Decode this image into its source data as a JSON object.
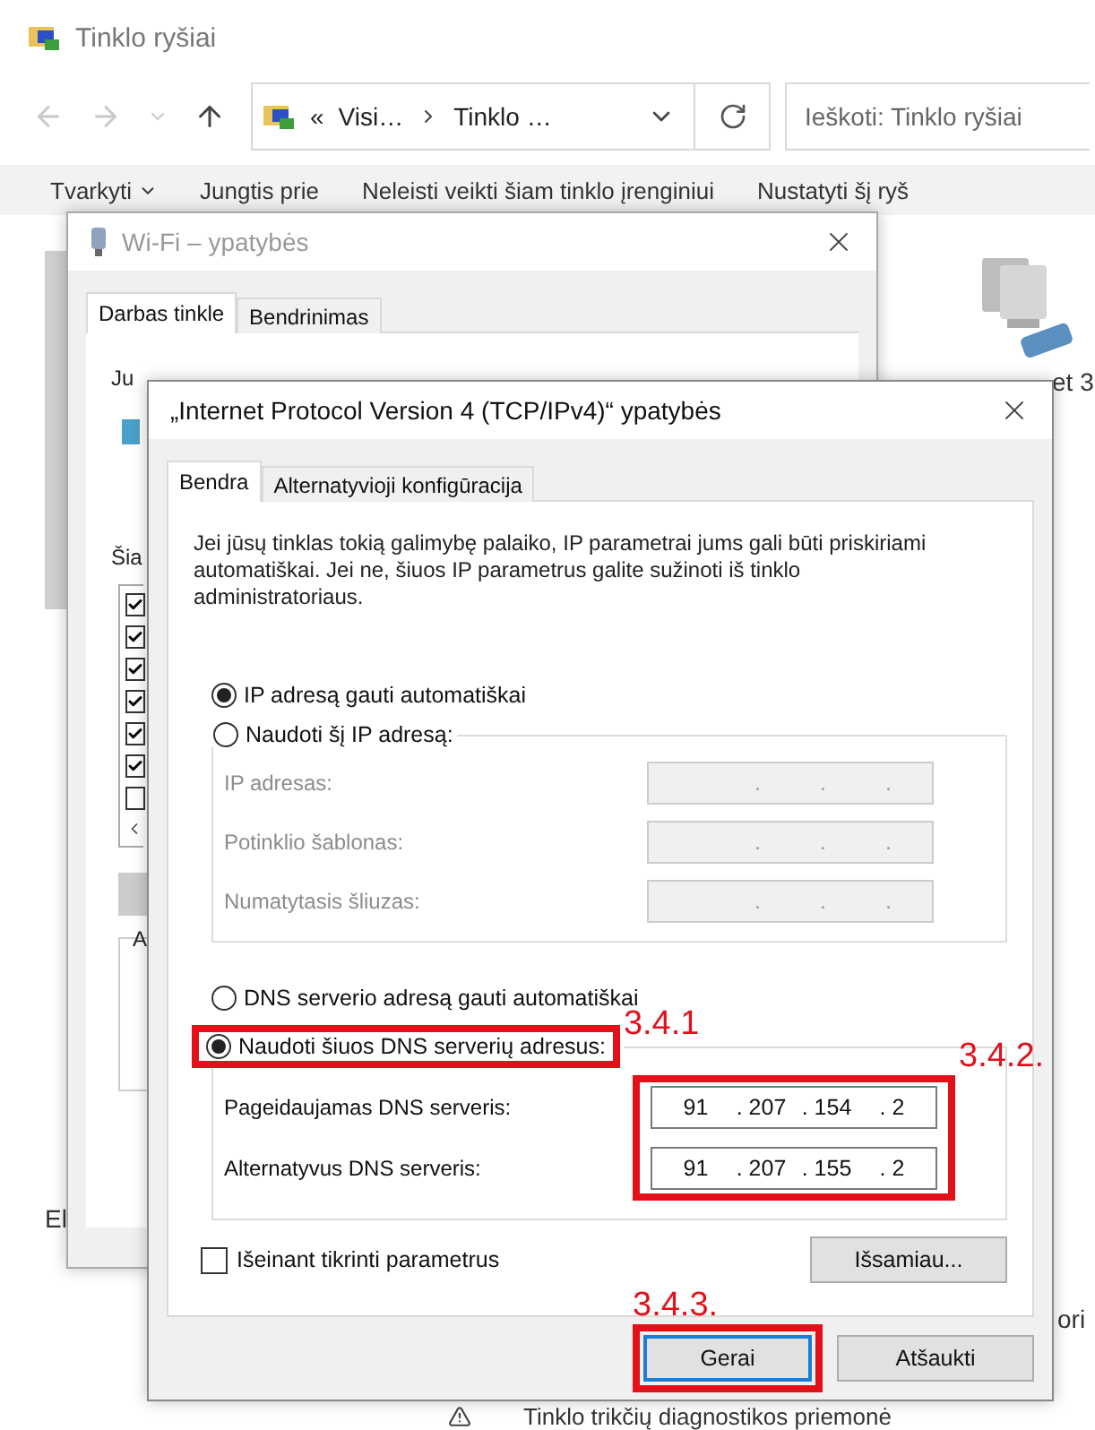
{
  "explorer": {
    "title": "Tinklo ryšiai",
    "address": {
      "overflow": "«",
      "segments": [
        "Visi…",
        "Tinklo …"
      ]
    },
    "search": {
      "placeholder": "Ieškoti: Tinklo ryšiai"
    },
    "toolbar": [
      {
        "label": "Tvarkyti",
        "dropdown": true
      },
      {
        "label": "Jungtis prie",
        "dropdown": false
      },
      {
        "label": "Neleisti veikti šiam tinklo įrenginiui",
        "dropdown": false
      },
      {
        "label": "Nustatyti šį ryš",
        "dropdown": false
      }
    ],
    "connection_label": "et 3",
    "left_fragment": "El",
    "right_fragment": "ori",
    "task": "Tinklo trikčių diagnostikos priemonė"
  },
  "wifi_window": {
    "title": "Wi-Fi – ypatybės",
    "tabs": [
      {
        "label": "Darbas tinkle",
        "selected": true
      },
      {
        "label": "Bendrinimas",
        "selected": false
      }
    ],
    "fragments": [
      "Ju",
      "Šia",
      "A"
    ],
    "components": [
      {
        "checked": true
      },
      {
        "checked": true
      },
      {
        "checked": true
      },
      {
        "checked": true
      },
      {
        "checked": true
      },
      {
        "checked": true
      },
      {
        "checked": false
      }
    ]
  },
  "ipv4_dialog": {
    "title": "„Internet Protocol Version 4 (TCP/IPv4)“ ypatybės",
    "tabs": [
      {
        "label": "Bendra",
        "selected": true
      },
      {
        "label": "Alternatyvioji konfigūracija",
        "selected": false
      }
    ],
    "description": "Jei jūsų tinklas tokią galimybę palaiko, IP parametrai jums gali būti priskiriami automatiškai. Jei ne, šiuos IP parametrus galite sužinoti iš tinklo administratoriaus.",
    "ip_mode": [
      {
        "label": "IP adresą gauti automatiškai",
        "selected": true
      },
      {
        "label": "Naudoti šį IP adresą:",
        "selected": false
      }
    ],
    "ip_fields": [
      {
        "label": "IP adresas:",
        "octets": [
          ".",
          ".",
          "."
        ],
        "disabled": true
      },
      {
        "label": "Potinklio šablonas:",
        "octets": [
          ".",
          ".",
          "."
        ],
        "disabled": true
      },
      {
        "label": "Numatytasis šliuzas:",
        "octets": [
          ".",
          ".",
          "."
        ],
        "disabled": true
      }
    ],
    "dns_mode": [
      {
        "label": "DNS serverio adresą gauti automatiškai",
        "selected": false
      },
      {
        "label": "Naudoti šiuos DNS serverių adresus:",
        "selected": true
      }
    ],
    "dns_fields": [
      {
        "label": "Pageidaujamas DNS serveris:",
        "octets": [
          "91",
          ". 207",
          ". 154",
          ". 2"
        ],
        "disabled": false
      },
      {
        "label": "Alternatyvus DNS serveris:",
        "octets": [
          "91",
          ". 207",
          ". 155",
          ". 2"
        ],
        "disabled": false
      }
    ],
    "validate": {
      "label": "Išeinant tikrinti parametrus",
      "checked": false
    },
    "advanced_button": "Išsamiau...",
    "buttons": [
      {
        "label": "Gerai",
        "default": true
      },
      {
        "label": "Atšaukti",
        "default": false
      }
    ]
  },
  "annotations": [
    {
      "label": "3.4.1"
    },
    {
      "label": "3.4.2."
    },
    {
      "label": "3.4.3."
    }
  ]
}
